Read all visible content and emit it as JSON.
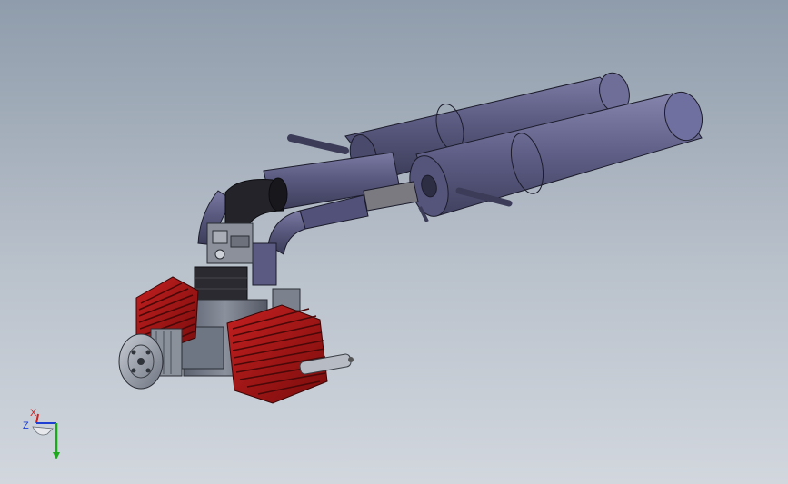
{
  "viewport": {
    "background_top": "#8f9cab",
    "background_bottom": "#d2d7de"
  },
  "model": {
    "colors": {
      "muffler": "#55557a",
      "muffler_dark": "#3a3a5a",
      "cylinder_fins": "#a31515",
      "cylinder_dark": "#5a0a0a",
      "crankcase": "#6f7684",
      "carburetor": "#8a8f99",
      "intake_black": "#1f1f24",
      "prop_hub": "#9aa0aa"
    }
  },
  "triad": {
    "x_label": "X",
    "z_label": "Z",
    "x_color": "#d21f1f",
    "y_color": "#1fa81f",
    "z_color": "#1f3fd2"
  }
}
